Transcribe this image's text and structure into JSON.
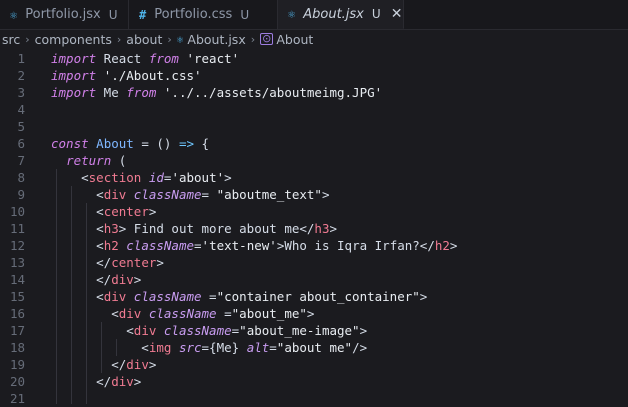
{
  "tabs": [
    {
      "icon": "react-icon",
      "glyph": "⚛",
      "name": "Portfolio.jsx",
      "status": "U",
      "active": false,
      "color": "#4fb3e8"
    },
    {
      "icon": "css-icon",
      "glyph": "#",
      "name": "Portfolio.css",
      "status": "U",
      "active": false,
      "color": "#4fb3e8"
    },
    {
      "icon": "react-icon",
      "glyph": "⚛",
      "name": "About.jsx",
      "status": "U",
      "active": true,
      "color": "#4fb3e8",
      "close": "✕"
    }
  ],
  "breadcrumb": {
    "parts": [
      "src",
      "components",
      "about"
    ],
    "file": "About.jsx",
    "symbol": "About"
  },
  "lines": [
    {
      "n": "1",
      "segs": [
        [
          "kw",
          "import"
        ],
        [
          "punc",
          " React "
        ],
        [
          "kw",
          "from"
        ],
        [
          "punc",
          " "
        ],
        [
          "str",
          "'react'"
        ]
      ]
    },
    {
      "n": "2",
      "segs": [
        [
          "kw",
          "import"
        ],
        [
          "punc",
          " "
        ],
        [
          "str",
          "'./About.css'"
        ]
      ]
    },
    {
      "n": "3",
      "segs": [
        [
          "kw",
          "import"
        ],
        [
          "punc",
          " Me "
        ],
        [
          "kw",
          "from"
        ],
        [
          "punc",
          " "
        ],
        [
          "str",
          "'../../assets/aboutmeimg.JPG'"
        ]
      ]
    },
    {
      "n": "4",
      "segs": []
    },
    {
      "n": "5",
      "segs": []
    },
    {
      "n": "6",
      "segs": [
        [
          "kw",
          "const"
        ],
        [
          "punc",
          " "
        ],
        [
          "fn",
          "About"
        ],
        [
          "punc",
          " = () "
        ],
        [
          "arrow",
          "=>"
        ],
        [
          "punc",
          " {"
        ]
      ]
    },
    {
      "n": "7",
      "segs": [
        [
          "punc",
          "  "
        ],
        [
          "kw",
          "return"
        ],
        [
          "punc",
          " ("
        ]
      ]
    },
    {
      "n": "8",
      "segs": [
        [
          "punc",
          "    <"
        ],
        [
          "tag",
          "section"
        ],
        [
          "punc",
          " "
        ],
        [
          "attr",
          "id"
        ],
        [
          "punc",
          "="
        ],
        [
          "str",
          "'about'"
        ],
        [
          "punc",
          ">"
        ]
      ]
    },
    {
      "n": "9",
      "segs": [
        [
          "punc",
          "      <"
        ],
        [
          "tag",
          "div"
        ],
        [
          "punc",
          " "
        ],
        [
          "attr",
          "className"
        ],
        [
          "punc",
          "= "
        ],
        [
          "str",
          "\"aboutme_text\""
        ],
        [
          "punc",
          ">"
        ]
      ]
    },
    {
      "n": "10",
      "segs": [
        [
          "punc",
          "      <"
        ],
        [
          "tag",
          "center"
        ],
        [
          "punc",
          ">"
        ]
      ]
    },
    {
      "n": "11",
      "segs": [
        [
          "punc",
          "      <"
        ],
        [
          "tag",
          "h3"
        ],
        [
          "punc",
          "> Find out more about me</"
        ],
        [
          "tag",
          "h3"
        ],
        [
          "punc",
          ">"
        ]
      ]
    },
    {
      "n": "12",
      "segs": [
        [
          "punc",
          "      <"
        ],
        [
          "tag",
          "h2"
        ],
        [
          "punc",
          " "
        ],
        [
          "attr",
          "className"
        ],
        [
          "punc",
          "="
        ],
        [
          "str",
          "'text-new'"
        ],
        [
          "punc",
          ">Who is Iqra Irfan?</"
        ],
        [
          "tag",
          "h2"
        ],
        [
          "punc",
          ">"
        ]
      ]
    },
    {
      "n": "13",
      "segs": [
        [
          "punc",
          "      </"
        ],
        [
          "tag",
          "center"
        ],
        [
          "punc",
          ">"
        ]
      ]
    },
    {
      "n": "14",
      "segs": [
        [
          "punc",
          "      </"
        ],
        [
          "tag",
          "div"
        ],
        [
          "punc",
          ">"
        ]
      ]
    },
    {
      "n": "15",
      "segs": [
        [
          "punc",
          "      <"
        ],
        [
          "tag",
          "div"
        ],
        [
          "punc",
          " "
        ],
        [
          "attr",
          "className"
        ],
        [
          "punc",
          " ="
        ],
        [
          "str",
          "\"container about_container\""
        ],
        [
          "punc",
          ">"
        ]
      ]
    },
    {
      "n": "16",
      "segs": [
        [
          "punc",
          "        <"
        ],
        [
          "tag",
          "div"
        ],
        [
          "punc",
          " "
        ],
        [
          "attr",
          "className"
        ],
        [
          "punc",
          " ="
        ],
        [
          "str",
          "\"about_me\""
        ],
        [
          "punc",
          ">"
        ]
      ]
    },
    {
      "n": "17",
      "segs": [
        [
          "punc",
          "          <"
        ],
        [
          "tag",
          "div"
        ],
        [
          "punc",
          " "
        ],
        [
          "attr",
          "className"
        ],
        [
          "punc",
          "="
        ],
        [
          "str",
          "\"about_me-image\""
        ],
        [
          "punc",
          ">"
        ]
      ]
    },
    {
      "n": "18",
      "segs": [
        [
          "punc",
          "            <"
        ],
        [
          "tag",
          "img"
        ],
        [
          "punc",
          " "
        ],
        [
          "attr",
          "src"
        ],
        [
          "punc",
          "={Me} "
        ],
        [
          "attr",
          "alt"
        ],
        [
          "punc",
          "="
        ],
        [
          "str",
          "\"about me\""
        ],
        [
          "punc",
          "/>"
        ]
      ]
    },
    {
      "n": "19",
      "segs": [
        [
          "punc",
          "        </"
        ],
        [
          "tag",
          "div"
        ],
        [
          "punc",
          ">"
        ]
      ]
    },
    {
      "n": "20",
      "segs": [
        [
          "punc",
          "      </"
        ],
        [
          "tag",
          "div"
        ],
        [
          "punc",
          ">"
        ]
      ]
    },
    {
      "n": "21",
      "segs": []
    }
  ]
}
